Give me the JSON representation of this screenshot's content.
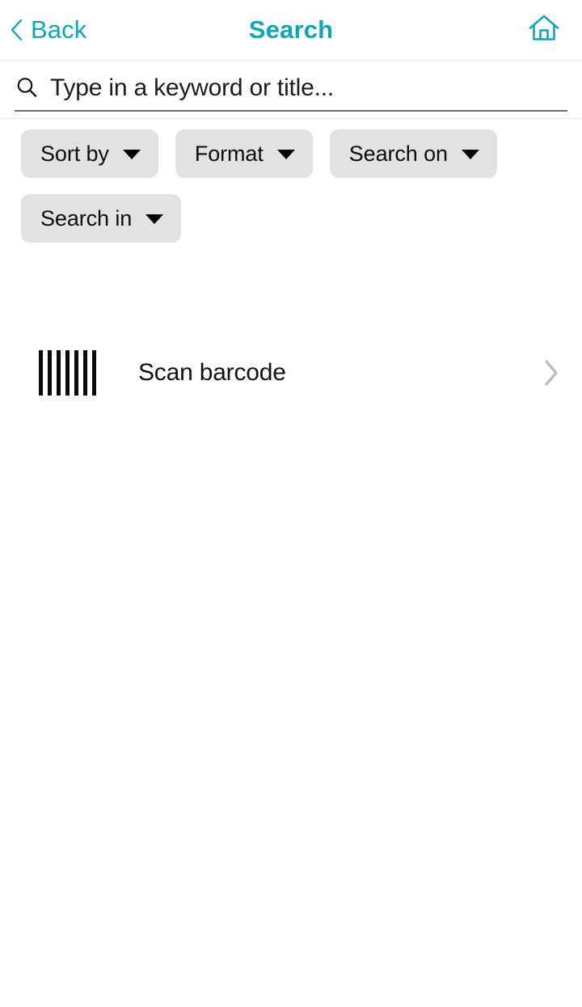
{
  "header": {
    "back_label": "Back",
    "title": "Search",
    "back_icon": "chevron-left-icon",
    "home_icon": "home-icon",
    "accent_color": "#0FA6B7"
  },
  "search": {
    "icon": "search-icon",
    "value": "",
    "placeholder": "Type in a keyword or title..."
  },
  "filters": {
    "chips": [
      {
        "label": "Sort by",
        "icon": "chevron-down-icon"
      },
      {
        "label": "Format",
        "icon": "chevron-down-icon"
      },
      {
        "label": "Search on",
        "icon": "chevron-down-icon"
      },
      {
        "label": "Search in",
        "icon": "chevron-down-icon"
      }
    ],
    "chip_background": "#E2E2E2"
  },
  "actions": {
    "scan": {
      "label": "Scan barcode",
      "icon": "barcode-icon",
      "disclosure_icon": "chevron-right-icon",
      "disclosure_color": "#BDBDBD"
    }
  }
}
